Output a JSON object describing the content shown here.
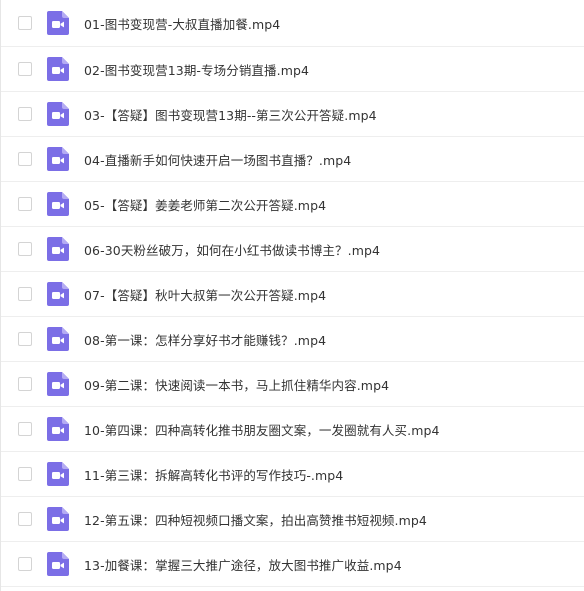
{
  "files": [
    {
      "name": "01-图书变现营-大叔直播加餐.mp4",
      "icon": "video-file-icon"
    },
    {
      "name": "02-图书变现营13期-专场分销直播.mp4",
      "icon": "video-file-icon"
    },
    {
      "name": "03-【答疑】图书变现营13期--第三次公开答疑.mp4",
      "icon": "video-file-icon"
    },
    {
      "name": "04-直播新手如何快速开启一场图书直播？.mp4",
      "icon": "video-file-icon"
    },
    {
      "name": "05-【答疑】姜姜老师第二次公开答疑.mp4",
      "icon": "video-file-icon"
    },
    {
      "name": "06-30天粉丝破万，如何在小红书做读书博主？.mp4",
      "icon": "video-file-icon"
    },
    {
      "name": "07-【答疑】秋叶大叔第一次公开答疑.mp4",
      "icon": "video-file-icon"
    },
    {
      "name": "08-第一课：怎样分享好书才能赚钱？.mp4",
      "icon": "video-file-icon"
    },
    {
      "name": "09-第二课：快速阅读一本书，马上抓住精华内容.mp4",
      "icon": "video-file-icon"
    },
    {
      "name": "10-第四课：四种高转化推书朋友圈文案，一发圈就有人买.mp4",
      "icon": "video-file-icon"
    },
    {
      "name": "11-第三课：拆解高转化书评的写作技巧-.mp4",
      "icon": "video-file-icon"
    },
    {
      "name": "12-第五课：四种短视频口播文案，拍出高赞推书短视频.mp4",
      "icon": "video-file-icon"
    },
    {
      "name": "13-加餐课：掌握三大推广途径，放大图书推广收益.mp4",
      "icon": "video-file-icon"
    }
  ],
  "colors": {
    "icon_body": "#7b6ee6",
    "icon_fold": "#b4abf3",
    "text": "#333333",
    "divider": "#eeeeee",
    "checkbox_border": "#d4d4d4"
  }
}
